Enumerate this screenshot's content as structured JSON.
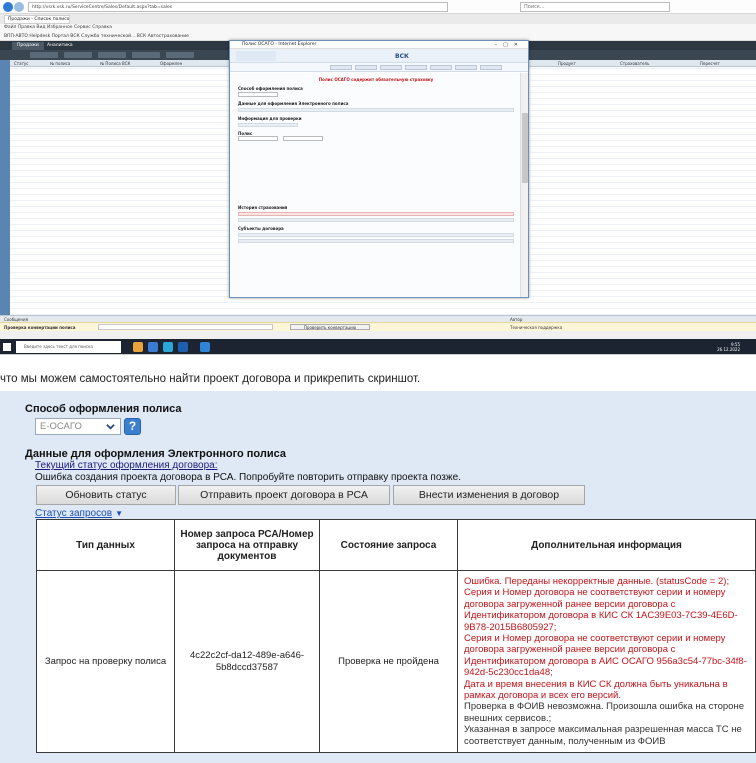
{
  "screenshot": {
    "address": "http://vsrk.vsk.ru/ServiceCentre/Sales/Default.aspx?tab=sales",
    "search_placeholder": "Поиск...",
    "tab_title": "Продажи - Список полисов",
    "menu": "Файл  Правка  Вид  Избранное  Сервис  Справка",
    "favorites": "ВПП-АВТО   Helpdesk   Портал ВСК   Служба технической...   ВСК Автострахование",
    "app_tabs": [
      "Продажи",
      "Аналитика"
    ],
    "columns": [
      "Статус",
      "№ полиса",
      "№ Полиса ВСК",
      "Оформлен",
      "Продукт",
      "Страхователь",
      "Пересчет"
    ],
    "status_left": "Сообщения",
    "status_right": "Автор",
    "search_label": "Проверка конвертации полиса",
    "check_button": "Проверить конвертацию",
    "support": "Техническая поддержка",
    "taskbar_search": "Введите здесь текст для поиска",
    "clock_time": "9:55",
    "clock_date": "26.12.2022",
    "popup": {
      "title": "Полис ОСАГО - Internet Explorer",
      "brand": "ВСК",
      "warning": "Полис ОСАГО содержит обязательную страховку",
      "section_method": "Способ оформления полиса",
      "section_data": "Данные для оформления Электронного полиса",
      "section_verify": "Информация для проверки",
      "section_policy": "Полис",
      "section_history": "История страхования",
      "section_subjects": "Субъекты договора"
    }
  },
  "caption": "что мы можем самостоятельно найти проект договора и прикрепить скриншот.",
  "zoom": {
    "method_title": "Способ оформления полиса",
    "method_value": "Е-ОСАГО",
    "help_label": "?",
    "data_title": "Данные для оформления Электронного полиса",
    "status_link": "Текущий статус оформления договора:",
    "status_error": "Ошибка создания проекта договора в РСА. Попробуйте повторить отправку проекта позже.",
    "buttons": {
      "refresh": "Обновить статус",
      "send": "Отправить проект договора в РСА",
      "edit": "Внести изменения в договор"
    },
    "requests_link": "Статус запросов",
    "table": {
      "headers": [
        "Тип данных",
        "Номер запроса РСА/Номер запроса на отправку документов",
        "Состояние запроса",
        "Дополнительная информация"
      ],
      "row": {
        "type": "Запрос на проверку полиса",
        "request_id": "4c22c2cf-da12-489e-a646-5b8dccd37587",
        "state": "Проверка не пройдена",
        "info_red": [
          "Ошибка. Переданы некорректные данные. (statusCode = 2);",
          "Серия и Номер договора не соответствуют серии и номеру договора загруженной ранее версии договора с Идентификатором договора в КИС СК 1AC39E03-7C39-4E6D-9B78-2015B6805927;",
          "Серия и Номер договора не соответствуют серии и номеру договора загруженной ранее версии договора с Идентификатором договора в АИС ОСАГО 956a3c54-77bc-34f8-942d-5c230cc1da48;",
          "Дата и время внесения в КИС СК должна быть уникальна в рамках договора и всех его версий."
        ],
        "info_grey": [
          "Проверка в ФОИВ невозможна. Произошла ошибка на стороне внешних сервисов.;",
          "Указанная в запросе максимальная разрешенная масса ТС не соответствует данным, полученным из ФОИВ"
        ]
      }
    }
  }
}
